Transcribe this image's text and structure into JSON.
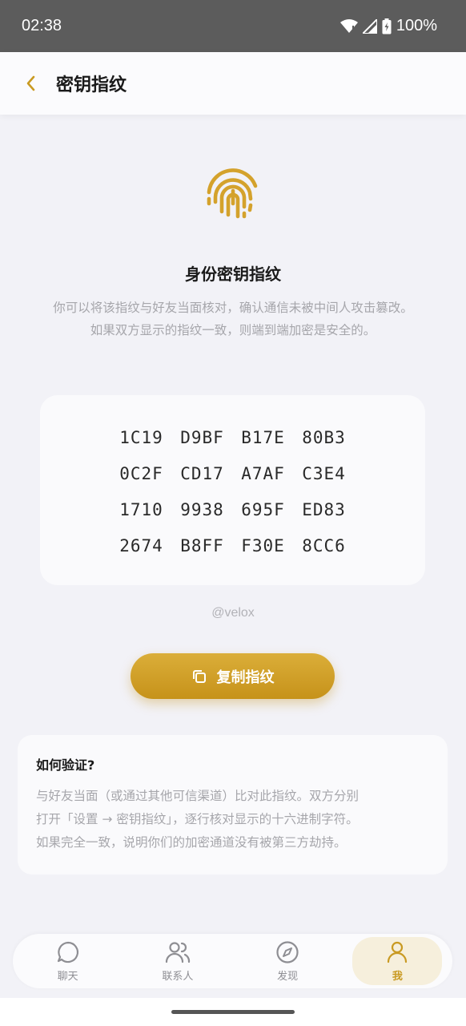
{
  "status": {
    "time": "02:38",
    "battery": "100%"
  },
  "header": {
    "title": "密钥指纹"
  },
  "identity": {
    "title": "身份密钥指纹",
    "desc_line1": "你可以将该指纹与好友当面核对，确认通信未被中间人攻击篡改。",
    "desc_line2": "如果双方显示的指纹一致，则端到端加密是安全的。"
  },
  "fingerprint": {
    "rows": [
      [
        "1C19",
        "D9BF",
        "B17E",
        "80B3"
      ],
      [
        "0C2F",
        "CD17",
        "A7AF",
        "C3E4"
      ],
      [
        "1710",
        "9938",
        "695F",
        "ED83"
      ],
      [
        "2674",
        "B8FF",
        "F30E",
        "8CC6"
      ]
    ]
  },
  "user": {
    "handle": "@velox"
  },
  "copy_button": {
    "label": "复制指纹"
  },
  "help": {
    "title": "如何验证?",
    "line1": "与好友当面（或通过其他可信渠道）比对此指纹。双方分别",
    "line2": "打开「设置 → 密钥指纹」，逐行核对显示的十六进制字符。",
    "line3": "如果完全一致，说明你们的加密通道没有被第三方劫持。"
  },
  "tabs": [
    {
      "label": "聊天",
      "icon": "chat-icon"
    },
    {
      "label": "联系人",
      "icon": "contacts-icon"
    },
    {
      "label": "发现",
      "icon": "compass-icon"
    },
    {
      "label": "我",
      "icon": "person-icon",
      "active": true
    }
  ],
  "colors": {
    "accent": "#c99a22",
    "accent_light": "#f6efdc",
    "status_bar": "#5c5c5c"
  }
}
